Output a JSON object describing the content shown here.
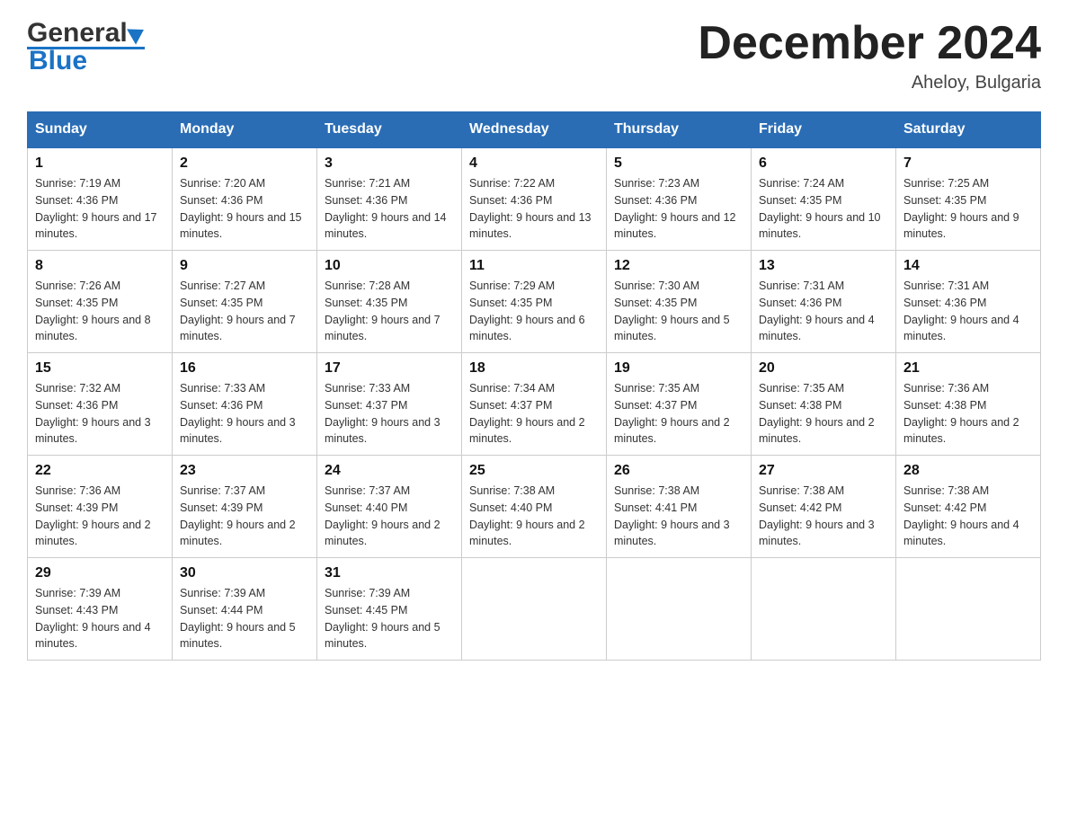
{
  "header": {
    "logo_text_black": "General",
    "logo_text_blue": "Blue",
    "month_title": "December 2024",
    "location": "Aheloy, Bulgaria"
  },
  "days_header": [
    "Sunday",
    "Monday",
    "Tuesday",
    "Wednesday",
    "Thursday",
    "Friday",
    "Saturday"
  ],
  "weeks": [
    [
      {
        "day": "1",
        "sunrise": "7:19 AM",
        "sunset": "4:36 PM",
        "daylight": "9 hours and 17 minutes."
      },
      {
        "day": "2",
        "sunrise": "7:20 AM",
        "sunset": "4:36 PM",
        "daylight": "9 hours and 15 minutes."
      },
      {
        "day": "3",
        "sunrise": "7:21 AM",
        "sunset": "4:36 PM",
        "daylight": "9 hours and 14 minutes."
      },
      {
        "day": "4",
        "sunrise": "7:22 AM",
        "sunset": "4:36 PM",
        "daylight": "9 hours and 13 minutes."
      },
      {
        "day": "5",
        "sunrise": "7:23 AM",
        "sunset": "4:36 PM",
        "daylight": "9 hours and 12 minutes."
      },
      {
        "day": "6",
        "sunrise": "7:24 AM",
        "sunset": "4:35 PM",
        "daylight": "9 hours and 10 minutes."
      },
      {
        "day": "7",
        "sunrise": "7:25 AM",
        "sunset": "4:35 PM",
        "daylight": "9 hours and 9 minutes."
      }
    ],
    [
      {
        "day": "8",
        "sunrise": "7:26 AM",
        "sunset": "4:35 PM",
        "daylight": "9 hours and 8 minutes."
      },
      {
        "day": "9",
        "sunrise": "7:27 AM",
        "sunset": "4:35 PM",
        "daylight": "9 hours and 7 minutes."
      },
      {
        "day": "10",
        "sunrise": "7:28 AM",
        "sunset": "4:35 PM",
        "daylight": "9 hours and 7 minutes."
      },
      {
        "day": "11",
        "sunrise": "7:29 AM",
        "sunset": "4:35 PM",
        "daylight": "9 hours and 6 minutes."
      },
      {
        "day": "12",
        "sunrise": "7:30 AM",
        "sunset": "4:35 PM",
        "daylight": "9 hours and 5 minutes."
      },
      {
        "day": "13",
        "sunrise": "7:31 AM",
        "sunset": "4:36 PM",
        "daylight": "9 hours and 4 minutes."
      },
      {
        "day": "14",
        "sunrise": "7:31 AM",
        "sunset": "4:36 PM",
        "daylight": "9 hours and 4 minutes."
      }
    ],
    [
      {
        "day": "15",
        "sunrise": "7:32 AM",
        "sunset": "4:36 PM",
        "daylight": "9 hours and 3 minutes."
      },
      {
        "day": "16",
        "sunrise": "7:33 AM",
        "sunset": "4:36 PM",
        "daylight": "9 hours and 3 minutes."
      },
      {
        "day": "17",
        "sunrise": "7:33 AM",
        "sunset": "4:37 PM",
        "daylight": "9 hours and 3 minutes."
      },
      {
        "day": "18",
        "sunrise": "7:34 AM",
        "sunset": "4:37 PM",
        "daylight": "9 hours and 2 minutes."
      },
      {
        "day": "19",
        "sunrise": "7:35 AM",
        "sunset": "4:37 PM",
        "daylight": "9 hours and 2 minutes."
      },
      {
        "day": "20",
        "sunrise": "7:35 AM",
        "sunset": "4:38 PM",
        "daylight": "9 hours and 2 minutes."
      },
      {
        "day": "21",
        "sunrise": "7:36 AM",
        "sunset": "4:38 PM",
        "daylight": "9 hours and 2 minutes."
      }
    ],
    [
      {
        "day": "22",
        "sunrise": "7:36 AM",
        "sunset": "4:39 PM",
        "daylight": "9 hours and 2 minutes."
      },
      {
        "day": "23",
        "sunrise": "7:37 AM",
        "sunset": "4:39 PM",
        "daylight": "9 hours and 2 minutes."
      },
      {
        "day": "24",
        "sunrise": "7:37 AM",
        "sunset": "4:40 PM",
        "daylight": "9 hours and 2 minutes."
      },
      {
        "day": "25",
        "sunrise": "7:38 AM",
        "sunset": "4:40 PM",
        "daylight": "9 hours and 2 minutes."
      },
      {
        "day": "26",
        "sunrise": "7:38 AM",
        "sunset": "4:41 PM",
        "daylight": "9 hours and 3 minutes."
      },
      {
        "day": "27",
        "sunrise": "7:38 AM",
        "sunset": "4:42 PM",
        "daylight": "9 hours and 3 minutes."
      },
      {
        "day": "28",
        "sunrise": "7:38 AM",
        "sunset": "4:42 PM",
        "daylight": "9 hours and 4 minutes."
      }
    ],
    [
      {
        "day": "29",
        "sunrise": "7:39 AM",
        "sunset": "4:43 PM",
        "daylight": "9 hours and 4 minutes."
      },
      {
        "day": "30",
        "sunrise": "7:39 AM",
        "sunset": "4:44 PM",
        "daylight": "9 hours and 5 minutes."
      },
      {
        "day": "31",
        "sunrise": "7:39 AM",
        "sunset": "4:45 PM",
        "daylight": "9 hours and 5 minutes."
      },
      null,
      null,
      null,
      null
    ]
  ]
}
